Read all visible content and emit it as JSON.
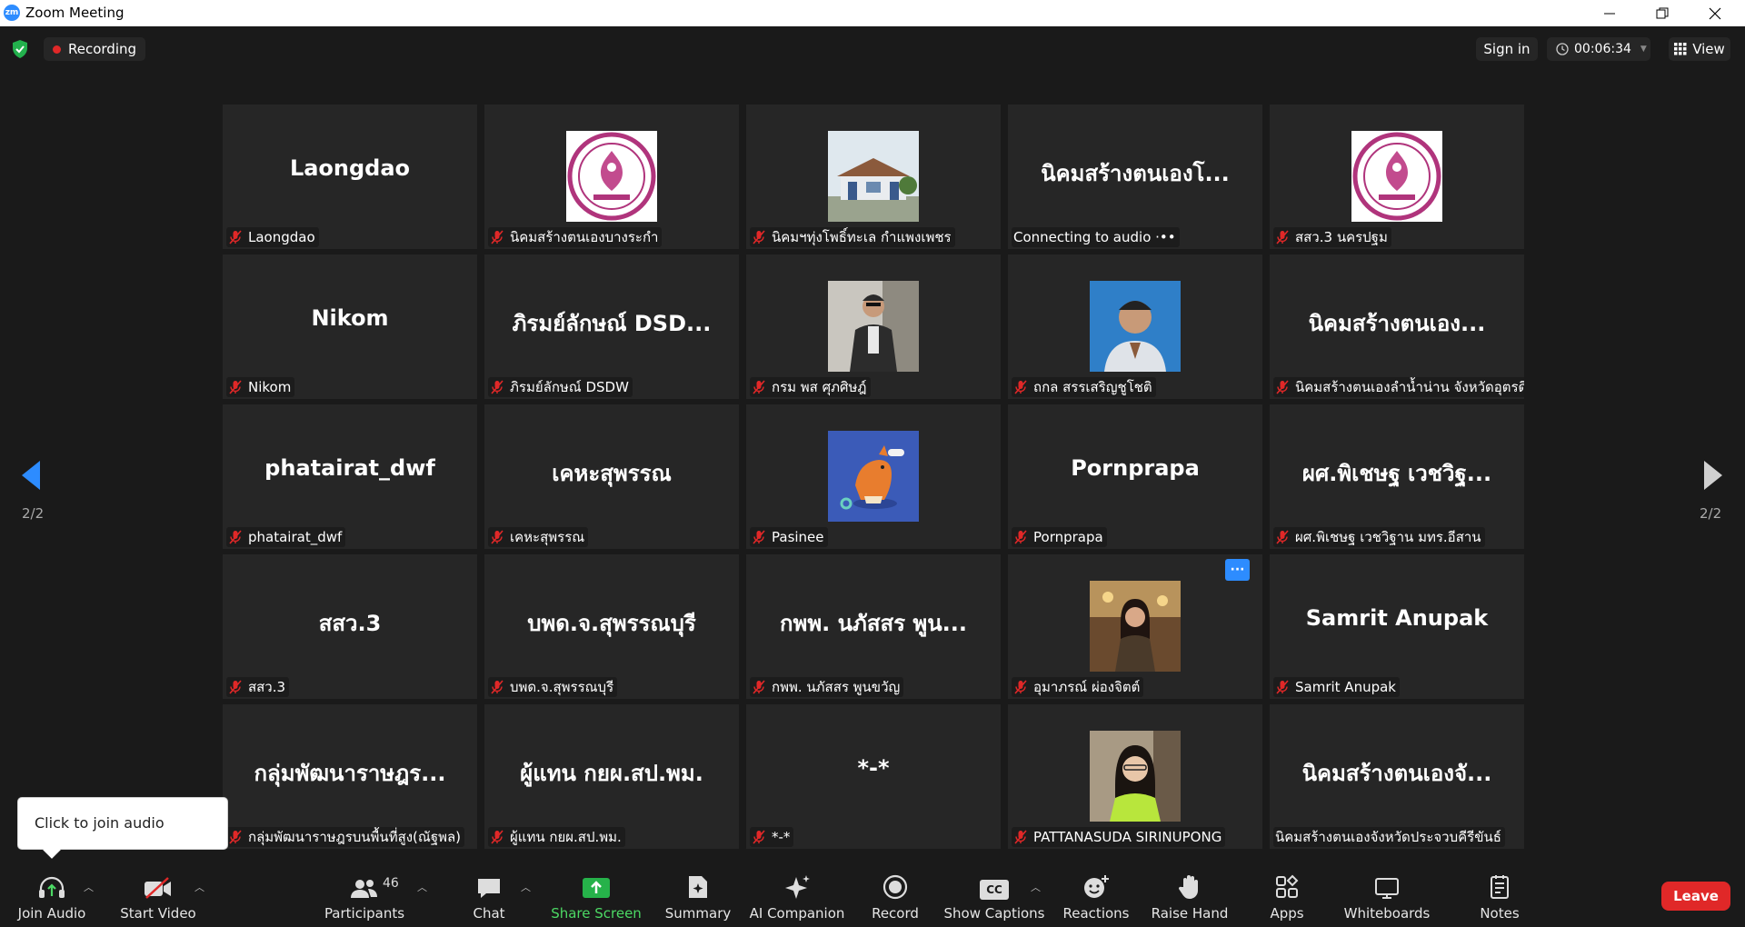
{
  "window": {
    "title": "Zoom Meeting",
    "logo_text": "zm"
  },
  "topbar": {
    "recording_label": "Recording",
    "sign_in_label": "Sign in",
    "timer": "00:06:34",
    "view_label": "View"
  },
  "pagination": {
    "left_page": "2/2",
    "right_page": "2/2"
  },
  "tiles": [
    {
      "big_name": "Laongdao",
      "label": "Laongdao",
      "muted": true
    },
    {
      "avatar": "seal",
      "label": "นิคมสร้างตนเองบางระกำ",
      "muted": true
    },
    {
      "avatar": "building-photo",
      "label": "นิคมฯทุ่งโพธิ์ทะเล กำแพงเพชร",
      "muted": true
    },
    {
      "big_name": "นิคมสร้างตนเองโ...",
      "label": "Connecting to audio ·••",
      "muted": false
    },
    {
      "avatar": "seal",
      "label": "สสว.3 นครปฐม",
      "muted": true
    },
    {
      "big_name": "Nikom",
      "label": "Nikom",
      "muted": true
    },
    {
      "big_name": "ภิรมย์ลักษณ์ DSD...",
      "label": "ภิรมย์ลักษณ์ DSDW",
      "muted": true
    },
    {
      "avatar": "man-photo",
      "label": "กรม พส ศุภศิษฎ์",
      "muted": true
    },
    {
      "avatar": "portrait-photo",
      "label": "ถกล สรรเสริญชูโชติ",
      "muted": true
    },
    {
      "big_name": "นิคมสร้างตนเอง...",
      "label": "นิคมสร้างตนเองลำน้ำน่าน จังหวัดอุตรดิตถ์",
      "muted": true
    },
    {
      "big_name": "phatairat_dwf",
      "label": "phatairat_dwf",
      "muted": true
    },
    {
      "big_name": "เคหะสุพรรณ",
      "label": "เคหะสุพรรณ",
      "muted": true
    },
    {
      "avatar": "cartoon-dog",
      "label": "Pasinee",
      "muted": true
    },
    {
      "big_name": "Pornprapa",
      "label": "Pornprapa",
      "muted": true
    },
    {
      "big_name": "ผศ.พิเชษฐ เวชวิฐ...",
      "label": "ผศ.พิเชษฐ เวชวิฐาน มทร.อีสาน",
      "muted": true
    },
    {
      "big_name": "สสว.3",
      "label": "สสว.3",
      "muted": true
    },
    {
      "big_name": "บพด.จ.สุพรรณบุรี",
      "label": "บพด.จ.สุพรรณบุรี",
      "muted": true
    },
    {
      "big_name": "กพพ. นภัสสร พูน...",
      "label": "กพพ. นภัสสร พูนขวัญ",
      "muted": true
    },
    {
      "avatar": "woman-photo",
      "label": "อุมาภรณ์ ผ่องจิตต์",
      "muted": true,
      "more_button": "···"
    },
    {
      "big_name": "Samrit Anupak",
      "label": "Samrit Anupak",
      "muted": true
    },
    {
      "big_name": "กลุ่มพัฒนาราษฎร...",
      "label": "กลุ่มพัฒนาราษฎรบนพื้นที่สูง(ณัฐพล)",
      "muted": true
    },
    {
      "big_name": "ผู้แทน กยผ.สป.พม.",
      "label": "ผู้แทน กยผ.สป.พม.",
      "muted": true
    },
    {
      "big_name": "*-*",
      "label": "*-*",
      "muted": true
    },
    {
      "avatar": "girl-photo",
      "label": "PATTANASUDA SIRINUPONG",
      "muted": true
    },
    {
      "big_name": "นิคมสร้างตนเองจั...",
      "label": "นิคมสร้างตนเองจังหวัดประจวบคีรีขันธ์",
      "muted": false
    }
  ],
  "tooltip": {
    "text": "Click to join audio"
  },
  "toolbar": {
    "join_audio": "Join Audio",
    "start_video": "Start Video",
    "participants": "Participants",
    "participants_count": "46",
    "chat": "Chat",
    "share_screen": "Share Screen",
    "summary": "Summary",
    "ai_companion": "AI Companion",
    "record": "Record",
    "show_captions": "Show Captions",
    "cc_badge": "CC",
    "reactions": "Reactions",
    "raise_hand": "Raise Hand",
    "apps": "Apps",
    "whiteboards": "Whiteboards",
    "notes": "Notes",
    "leave": "Leave"
  },
  "colors": {
    "accent_blue": "#2d8cff",
    "share_green": "#26b24a",
    "leave_red": "#e02828",
    "mic_muted_red": "#e02828"
  }
}
